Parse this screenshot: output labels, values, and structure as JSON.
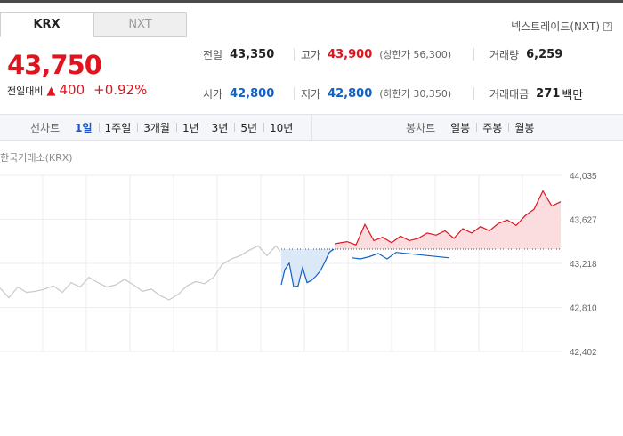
{
  "tabs": [
    {
      "label": "KRX",
      "active": true
    },
    {
      "label": "NXT",
      "active": false
    }
  ],
  "nxt_link": {
    "label": "넥스트레이드(NXT)",
    "help_icon": "?"
  },
  "price": {
    "current": "43,750",
    "change_label": "전일대비",
    "change_arrow": "▲",
    "change": "400",
    "change_pct": "+0.92%"
  },
  "stats": {
    "prev_close": {
      "label": "전일",
      "value": "43,350"
    },
    "high": {
      "label": "고가",
      "value": "43,900",
      "limit_label": "(상한가 56,300)"
    },
    "volume": {
      "label": "거래량",
      "value": "6,259"
    },
    "open": {
      "label": "시가",
      "value": "42,800"
    },
    "low": {
      "label": "저가",
      "value": "42,800",
      "limit_label": "(하한가 30,350)"
    },
    "turnover": {
      "label": "거래대금",
      "value": "271",
      "unit": "백만"
    }
  },
  "line_chart_periods": {
    "title": "선차트",
    "items": [
      "1일",
      "1주일",
      "3개월",
      "1년",
      "3년",
      "5년",
      "10년"
    ],
    "selected": "1일"
  },
  "candle_periods": {
    "title": "봉차트",
    "items": [
      "일봉",
      "주봉",
      "월봉"
    ]
  },
  "exchange_label": "한국거래소(KRX)",
  "colors": {
    "up": "#e0141e",
    "down": "#1261c4",
    "grid": "#eeeeee",
    "history": "#c8c8c8"
  },
  "chart_data": {
    "type": "line",
    "title": "",
    "xlabel": "",
    "ylabel": "",
    "y_ticks": [
      "44,035",
      "43,627",
      "43,218",
      "42,810",
      "42,402"
    ],
    "ylim": [
      42402,
      44035
    ],
    "baseline": 43350,
    "grid": true,
    "series": [
      {
        "x": [
          0,
          10,
          20,
          30,
          40,
          50,
          60,
          70,
          80,
          90,
          100,
          110,
          120,
          130,
          140,
          150,
          160,
          170,
          180,
          190,
          200,
          210,
          220,
          230,
          240,
          250,
          260,
          270,
          280,
          290,
          300,
          310,
          315
        ],
        "values": [
          42990,
          42900,
          43000,
          42950,
          42960,
          42980,
          43010,
          42950,
          43040,
          43000,
          43090,
          43040,
          43000,
          43020,
          43070,
          43020,
          42960,
          42980,
          42920,
          42880,
          42930,
          43010,
          43050,
          43030,
          43090,
          43210,
          43260,
          43290,
          43340,
          43380,
          43290,
          43380,
          43330
        ]
      },
      {
        "x": [
          316,
          320,
          325,
          330,
          335,
          340,
          345,
          350,
          355,
          360,
          365,
          370,
          375
        ],
        "values": [
          43020,
          43160,
          43220,
          43000,
          43010,
          43180,
          43040,
          43060,
          43100,
          43150,
          43230,
          43320,
          43350
        ]
      },
      {
        "x": [
          376,
          390,
          400,
          410,
          420,
          430,
          440,
          450,
          460,
          470,
          480,
          490,
          500,
          510,
          520,
          530,
          540,
          550,
          560,
          570,
          580,
          590,
          600,
          610,
          620,
          630
        ],
        "values": [
          43400,
          43420,
          43390,
          43580,
          43430,
          43460,
          43410,
          43470,
          43430,
          43450,
          43500,
          43480,
          43520,
          43450,
          43540,
          43500,
          43560,
          43520,
          43590,
          43620,
          43570,
          43660,
          43720,
          43890,
          43750,
          43790
        ]
      },
      {
        "x": [
          396,
          405,
          415,
          425,
          435,
          445,
          505
        ],
        "values": [
          43270,
          43260,
          43280,
          43310,
          43260,
          43320,
          43270
        ]
      }
    ],
    "x_positions_note": "series 0 = history, 1 = below prev close, 2 = above prev close, 3 = dips below"
  }
}
